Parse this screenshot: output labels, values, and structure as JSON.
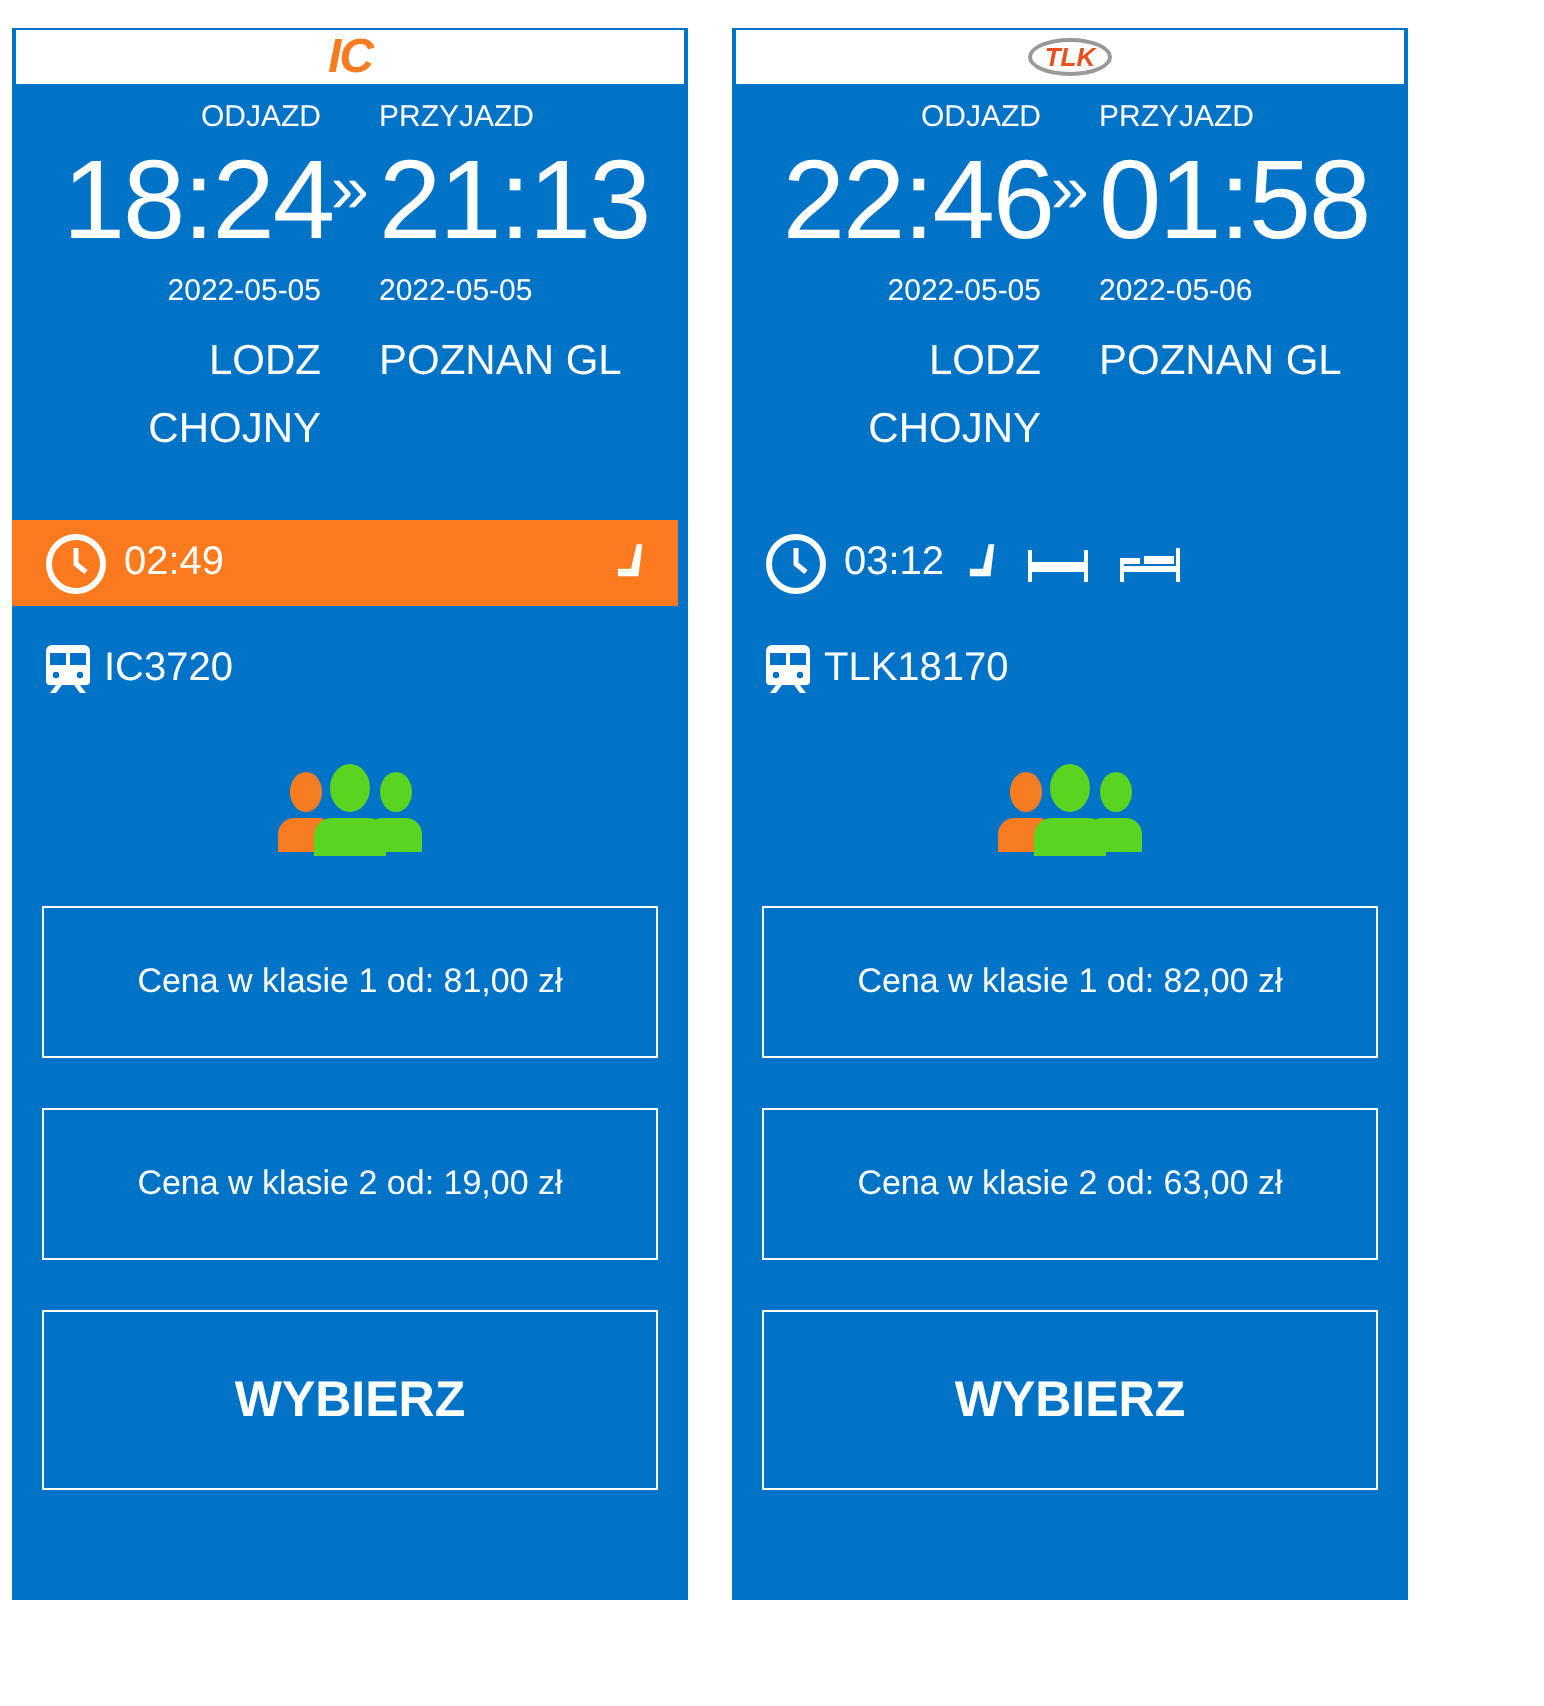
{
  "connections": [
    {
      "carrier_logo": "IC",
      "departure_label": "ODJAZD",
      "arrival_label": "PRZYJAZD",
      "departure_time": "18:24",
      "separator": "»",
      "arrival_time": "21:13",
      "departure_date": "2022-05-05",
      "arrival_date": "2022-05-05",
      "departure_station": "LODZ CHOJNY",
      "arrival_station": "POZNAN GL",
      "duration": "02:49",
      "highlighted": true,
      "amenities": [
        {
          "kind": "seat"
        }
      ],
      "train_number": "IC3720",
      "prices": [
        "Cena w klasie 1 od: 81,00 zł",
        "Cena w klasie 2 od: 19,00 zł"
      ],
      "select_button": "WYBIERZ"
    },
    {
      "carrier_logo": "TLK",
      "departure_label": "ODJAZD",
      "arrival_label": "PRZYJAZD",
      "departure_time": "22:46",
      "separator": "»",
      "arrival_time": "01:58",
      "departure_date": "2022-05-05",
      "arrival_date": "2022-05-06",
      "departure_station": "LODZ CHOJNY",
      "arrival_station": "POZNAN GL",
      "duration": "03:12",
      "highlighted": false,
      "amenities": [
        {
          "kind": "seat"
        },
        {
          "kind": "couchette"
        },
        {
          "kind": "sleeper"
        }
      ],
      "train_number": "TLK18170",
      "prices": [
        "Cena w klasie 1 od: 82,00 zł",
        "Cena w klasie 2 od: 63,00 zł"
      ],
      "select_button": "WYBIERZ"
    }
  ]
}
